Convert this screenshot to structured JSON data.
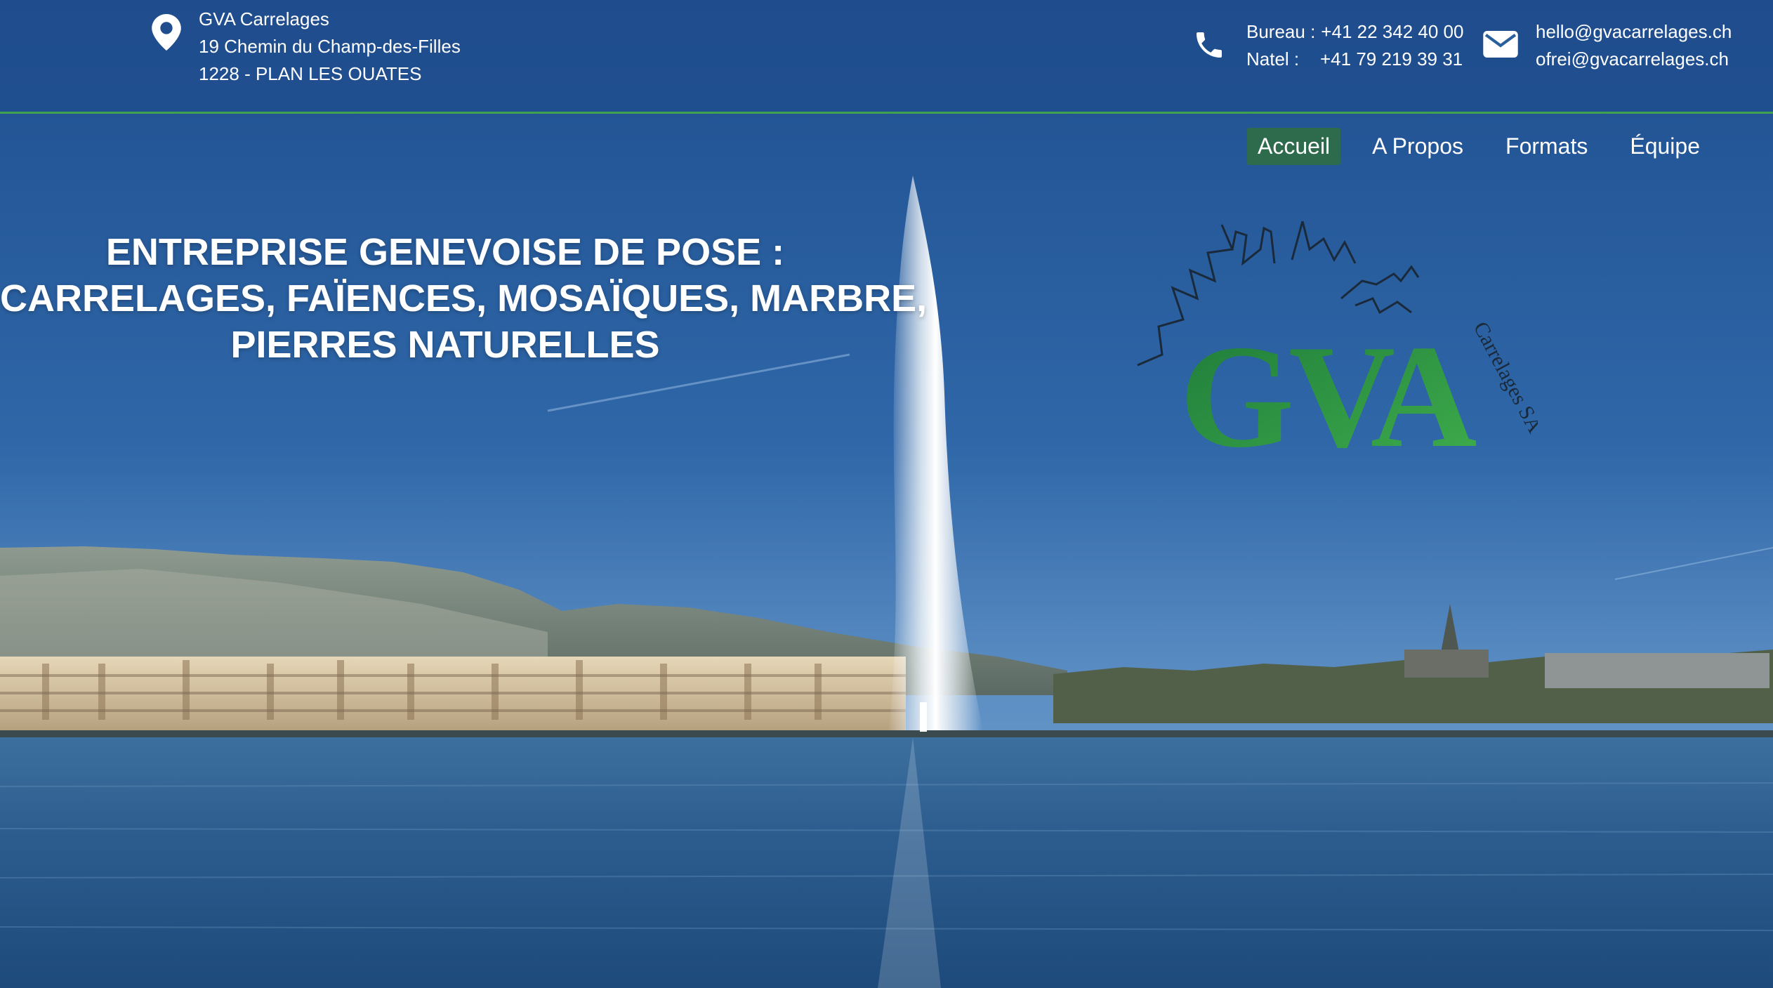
{
  "company": {
    "name": "GVA Carrelages",
    "street": "19 Chemin du Champ-des-Filles",
    "city": "1228 - PLAN LES OUATES"
  },
  "contact": {
    "bureau_label": "Bureau :",
    "bureau_number": "+41 22 342 40 00",
    "natel_label": "Natel :",
    "natel_number": "+41 79 219 39 31",
    "email_1": "hello@gvacarrelages.ch",
    "email_2": "ofrei@gvacarrelages.ch"
  },
  "nav": {
    "items": [
      {
        "label": "Accueil",
        "active": true
      },
      {
        "label": "A Propos",
        "active": false
      },
      {
        "label": "Formats",
        "active": false
      },
      {
        "label": "Équipe",
        "active": false
      }
    ]
  },
  "hero": {
    "line1": "ENTREPRISE GENEVOISE DE POSE :",
    "line2": "CARRELAGES, FAÏENCES, MOSAÏQUES, MARBRE,",
    "line3": "PIERRES NATURELLES"
  },
  "logo": {
    "mark": "GVA",
    "tagline": "Carrelages SA"
  },
  "icons": {
    "address": "map-pin-icon",
    "phone": "phone-icon",
    "email": "envelope-icon"
  },
  "colors": {
    "accent_green": "#3fa34d",
    "nav_active": "#2e6b4c",
    "logo_green": "#2f9a45"
  }
}
